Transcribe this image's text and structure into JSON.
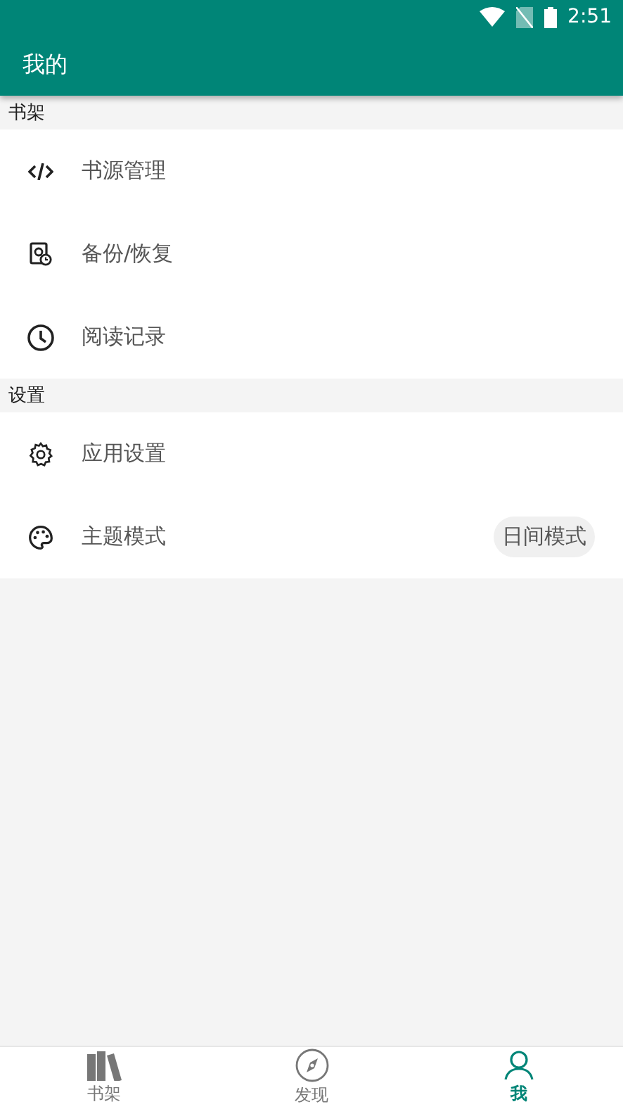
{
  "status_bar": {
    "time": "2:51"
  },
  "toolbar": {
    "title": "我的"
  },
  "sections": [
    {
      "title": "书架",
      "items": [
        {
          "label": "书源管理"
        },
        {
          "label": "备份/恢复"
        },
        {
          "label": "阅读记录"
        }
      ]
    },
    {
      "title": "设置",
      "items": [
        {
          "label": "应用设置"
        },
        {
          "label": "主题模式",
          "value": "日间模式"
        }
      ]
    }
  ],
  "bottom_nav": [
    {
      "label": "书架",
      "selected": false
    },
    {
      "label": "发现",
      "selected": false
    },
    {
      "label": "我",
      "selected": true
    }
  ]
}
